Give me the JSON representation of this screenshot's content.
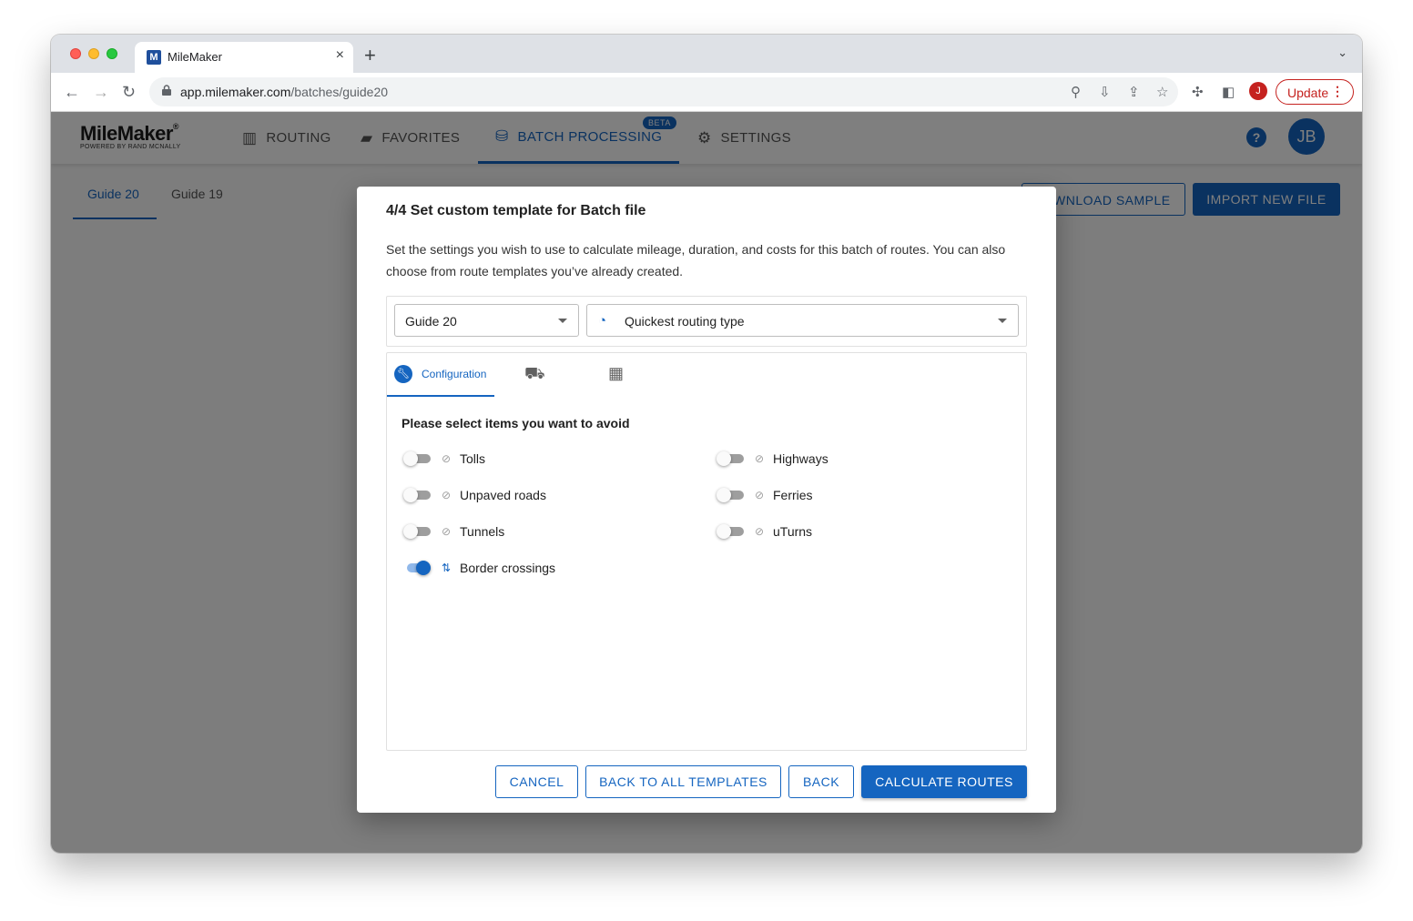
{
  "browser": {
    "tab_title": "MileMaker",
    "favicon_letter": "M",
    "url_host": "app.milemaker.com",
    "url_path": "/batches/guide20",
    "profile_initial": "J",
    "update_label": "Update"
  },
  "app": {
    "logo": "MileMaker",
    "logo_reg": "®",
    "logo_sub": "POWERED BY RAND MCNALLY",
    "nav": {
      "routing": "ROUTING",
      "favorites": "FAVORITES",
      "batch": "BATCH PROCESSING",
      "settings": "SETTINGS",
      "beta": "BETA"
    },
    "help": "?",
    "avatar": "JB",
    "subtabs": [
      "Guide 20",
      "Guide 19"
    ],
    "download_label": "DOWNLOAD SAMPLE",
    "import_label": "IMPORT NEW FILE"
  },
  "modal": {
    "title": "4/4 Set custom template for Batch file",
    "description": "Set the settings you wish to use to calculate mileage, duration, and costs for this batch of routes. You can also choose from route templates you’ve already created.",
    "template_select": "Guide 20",
    "routing_select": "Quickest routing type",
    "tabs": {
      "configuration": "Configuration"
    },
    "avoid_title": "Please select items you want to avoid",
    "options": [
      {
        "label": "Tolls",
        "on": false
      },
      {
        "label": "Highways",
        "on": false
      },
      {
        "label": "Unpaved roads",
        "on": false
      },
      {
        "label": "Ferries",
        "on": false
      },
      {
        "label": "Tunnels",
        "on": false
      },
      {
        "label": "uTurns",
        "on": false
      },
      {
        "label": "Border crossings",
        "on": true
      }
    ],
    "buttons": {
      "cancel": "CANCEL",
      "back_all": "BACK TO ALL TEMPLATES",
      "back": "BACK",
      "calculate": "CALCULATE ROUTES"
    }
  },
  "colors": {
    "accent": "#1565c0",
    "update": "#c5221f"
  }
}
